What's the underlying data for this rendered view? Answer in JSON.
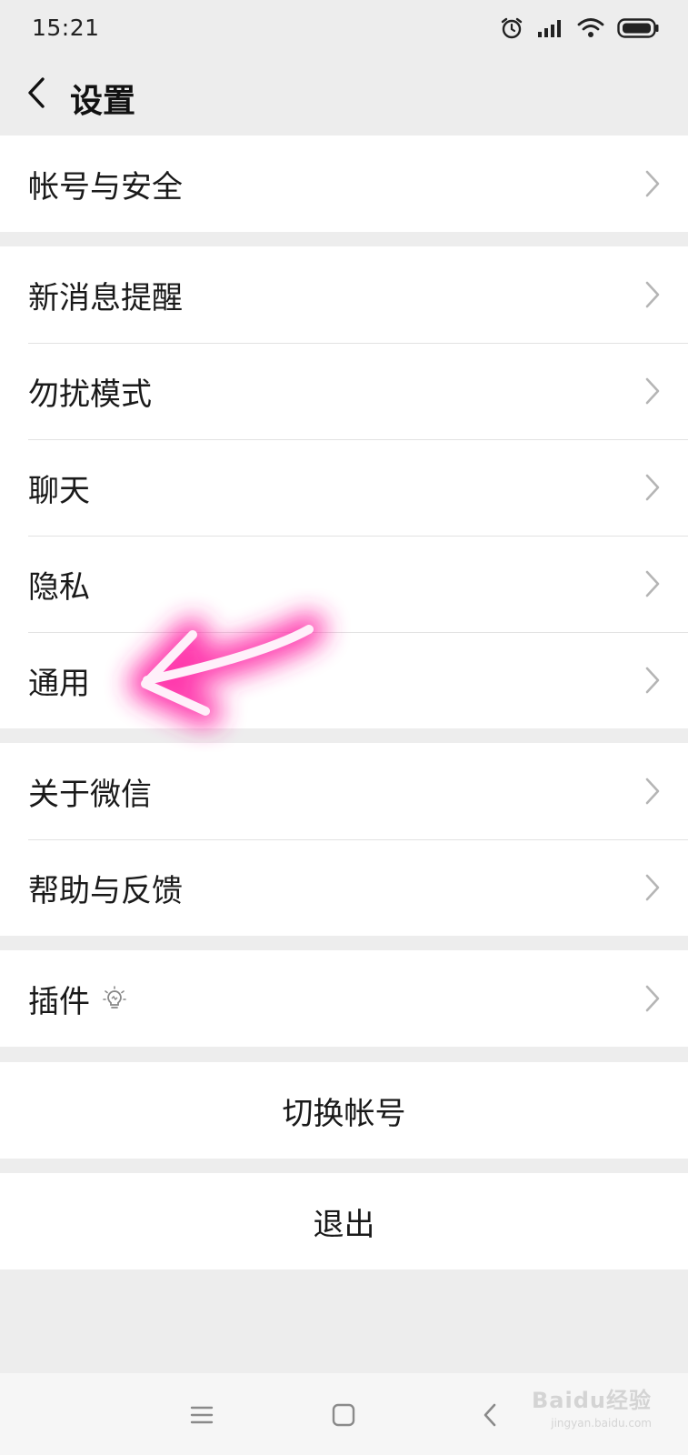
{
  "status_bar": {
    "time": "15:21",
    "icons": [
      "alarm-icon",
      "signal-icon",
      "wifi-icon",
      "battery-icon"
    ]
  },
  "nav": {
    "back_icon": "chevron-left-icon",
    "title": "设置"
  },
  "groups": [
    {
      "items": [
        {
          "label": "帐号与安全"
        }
      ]
    },
    {
      "items": [
        {
          "label": "新消息提醒"
        },
        {
          "label": "勿扰模式"
        },
        {
          "label": "聊天"
        },
        {
          "label": "隐私"
        },
        {
          "label": "通用"
        }
      ]
    },
    {
      "items": [
        {
          "label": "关于微信"
        },
        {
          "label": "帮助与反馈"
        }
      ]
    },
    {
      "items": [
        {
          "label": "插件",
          "icon": "lightbulb-icon"
        }
      ]
    }
  ],
  "actions": {
    "switch_account": "切换帐号",
    "logout": "退出"
  },
  "annotation": {
    "type": "arrow",
    "color": "#ff3fb4",
    "points_to": "通用"
  },
  "system_nav": {
    "icons": [
      "menu-icon",
      "home-icon",
      "back-icon"
    ]
  },
  "watermark": {
    "text": "Baidu经验",
    "sub": "jingyan.baidu.com"
  },
  "colors": {
    "background": "#ededed",
    "card": "#ffffff",
    "divider": "#e2e2e2",
    "annotation": "#ff3fb4"
  }
}
